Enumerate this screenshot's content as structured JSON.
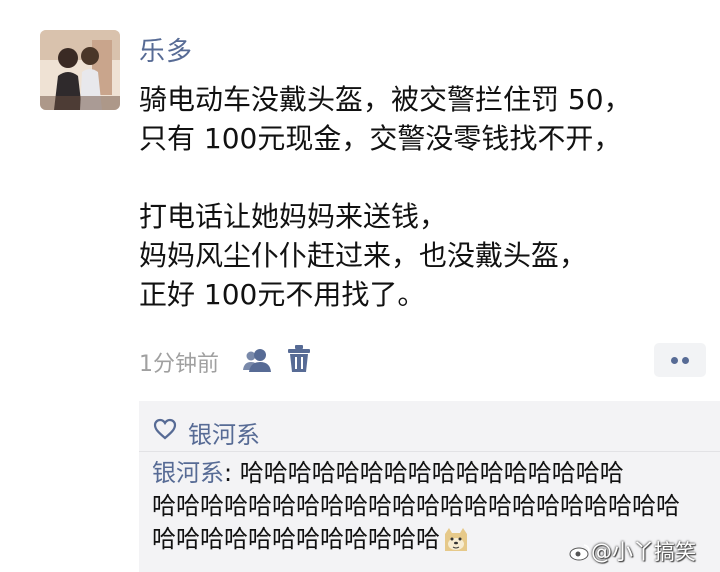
{
  "post": {
    "username": "乐多",
    "lines": [
      "骑电动车没戴头盔，被交警拦住罚 50，",
      "只有 100元现金，交警没零钱找不开，",
      "",
      "打电话让她妈妈来送钱，",
      "妈妈风尘仆仆赶过来，也没戴头盔，",
      "正好 100元不用找了。"
    ],
    "time": "1分钟前"
  },
  "comments": {
    "like_name": "银河系",
    "author": "银河系",
    "separator": ": ",
    "line1": "哈哈哈哈哈哈哈哈哈哈哈哈哈哈哈哈",
    "line2": "哈哈哈哈哈哈哈哈哈哈哈哈哈哈哈哈哈哈哈哈哈哈",
    "line3": "哈哈哈哈哈哈哈哈哈哈哈哈"
  },
  "watermark": {
    "text": "@小丫搞笑"
  },
  "colors": {
    "link": "#576b95",
    "meta": "#a0a0a0",
    "panel": "#f3f3f5"
  },
  "icons": [
    "avatar",
    "contacts-icon",
    "trash-icon",
    "more-icon",
    "heart-icon",
    "doge-emoji-icon",
    "weibo-icon"
  ]
}
